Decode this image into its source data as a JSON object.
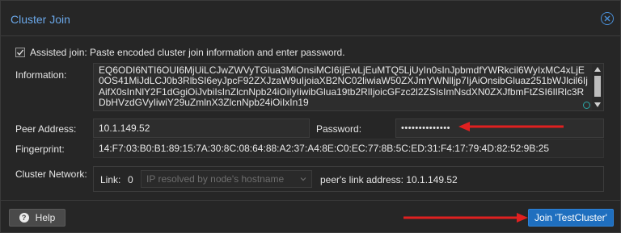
{
  "dialog": {
    "title": "Cluster Join",
    "close_icon": "close-circle-icon"
  },
  "assisted": {
    "checked": true,
    "label": "Assisted join: Paste encoded cluster join information and enter password."
  },
  "information": {
    "label": "Information:",
    "value": "EQ6ODI6NTI6OUI6MjUiLCJwZWVyTGlua3MiOnsiMCI6IjEwLjEuMTQ5LjUyIn0sInJpbmdfYWRkcil6WyIxMC4xLjE0OS41MiJdLCJ0b3RlbSI6eyJpcF92ZXJzaW9uIjoiaXB2NC02liwiaW50ZXJmYWNlljp7IjAiOnsibGluaz251bWJlcil6IjAifX0sInNlY2F1dGgiOiJvbiIsInZlcnNpb24iOiIyIiwibGlua19tb2RlIjoicGFzc2l2ZSIsImNsdXN0ZXJfbmFtZSI6IlRlc3RDbHVzdGVyIiwiY29uZmlnX3ZlcnNpb24iOiIxIn19"
  },
  "peer_address": {
    "label": "Peer Address:",
    "value": "10.1.149.52"
  },
  "password": {
    "label": "Password:",
    "value": "••••••••••••••"
  },
  "fingerprint": {
    "label": "Fingerprint:",
    "value": "14:F7:03:B0:B1:89:15:7A:30:8C:08:64:88:A2:37:A4:8E:C0:EC:77:8B:5C:ED:31:F4:17:79:4D:82:52:9B:25"
  },
  "cluster_network": {
    "label": "Cluster Network:",
    "link_label": "Link:",
    "link_number": "0",
    "link_select_value": "IP resolved by node's hostname",
    "peer_link_text": "peer's link address: 10.1.149.52"
  },
  "footer": {
    "help_label": "Help",
    "join_label": "Join 'TestCluster'"
  },
  "colors": {
    "title": "#6aa7e8",
    "join_button": "#1f6fbf",
    "arrow": "#e02020"
  }
}
